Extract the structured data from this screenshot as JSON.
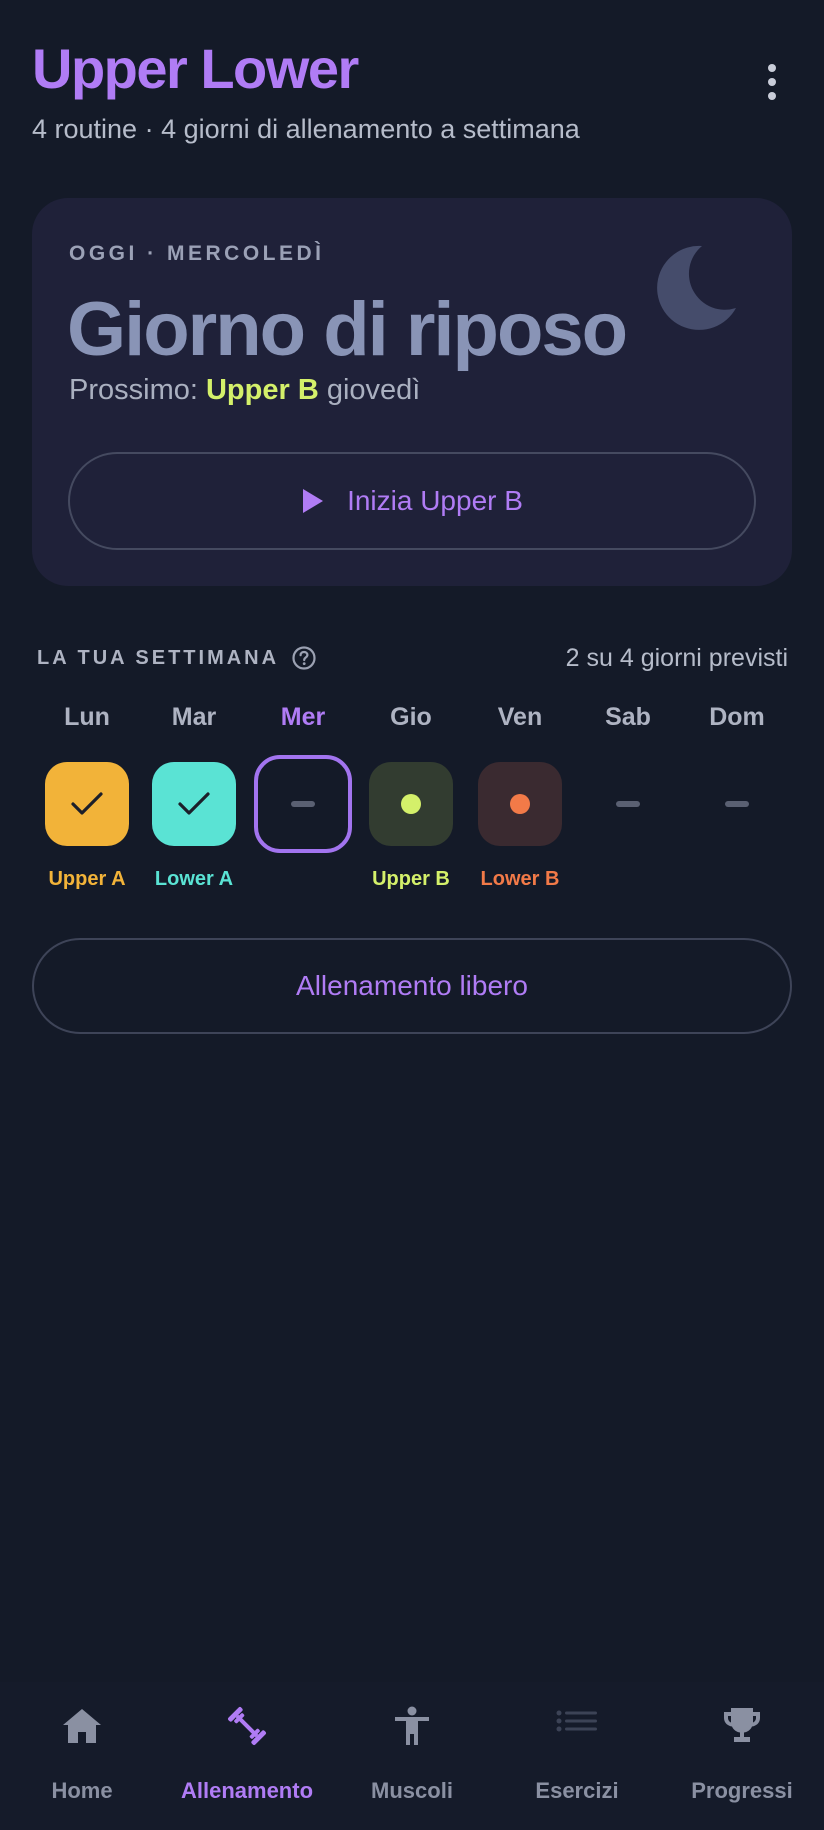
{
  "header": {
    "title": "Upper Lower",
    "subtitle": "4 routine · 4 giorni di allenamento a settimana",
    "menu_icon": "more-vert-icon"
  },
  "today": {
    "eyebrow": "OGGI · MERCOLEDÌ",
    "title": "Giorno di riposo",
    "next_prefix": "Prossimo:",
    "next_routine": "Upper B",
    "next_day": "giovedì",
    "start_label": "Inizia Upper B",
    "icon": "moon-icon"
  },
  "week": {
    "title": "LA TUA SETTIMANA",
    "count": "2 su 4 giorni previsti",
    "days": [
      {
        "name": "Lun",
        "label": "Upper A",
        "state": "done",
        "color": "#f2b339"
      },
      {
        "name": "Mar",
        "label": "Lower A",
        "state": "done",
        "color": "#5ae3d4"
      },
      {
        "name": "Mer",
        "label": "",
        "state": "today-rest",
        "color": "#a274ef"
      },
      {
        "name": "Gio",
        "label": "Upper B",
        "state": "planned",
        "color": "#d4f06a"
      },
      {
        "name": "Ven",
        "label": "Lower B",
        "state": "planned",
        "color": "#f27a48"
      },
      {
        "name": "Sab",
        "label": "",
        "state": "rest",
        "color": "#5a6072"
      },
      {
        "name": "Dom",
        "label": "",
        "state": "rest",
        "color": "#5a6072"
      }
    ]
  },
  "free_workout_label": "Allenamento libero",
  "nav": {
    "items": [
      {
        "label": "Home",
        "icon": "home-icon",
        "active": false
      },
      {
        "label": "Allenamento",
        "icon": "dumbbell-icon",
        "active": true
      },
      {
        "label": "Muscoli",
        "icon": "person-icon",
        "active": false
      },
      {
        "label": "Esercizi",
        "icon": "list-icon",
        "active": false
      },
      {
        "label": "Progressi",
        "icon": "trophy-icon",
        "active": false
      }
    ]
  },
  "colors": {
    "accent": "#b07cf5",
    "background": "#141a28",
    "card": "#1f2139",
    "highlight": "#d4f06a"
  }
}
